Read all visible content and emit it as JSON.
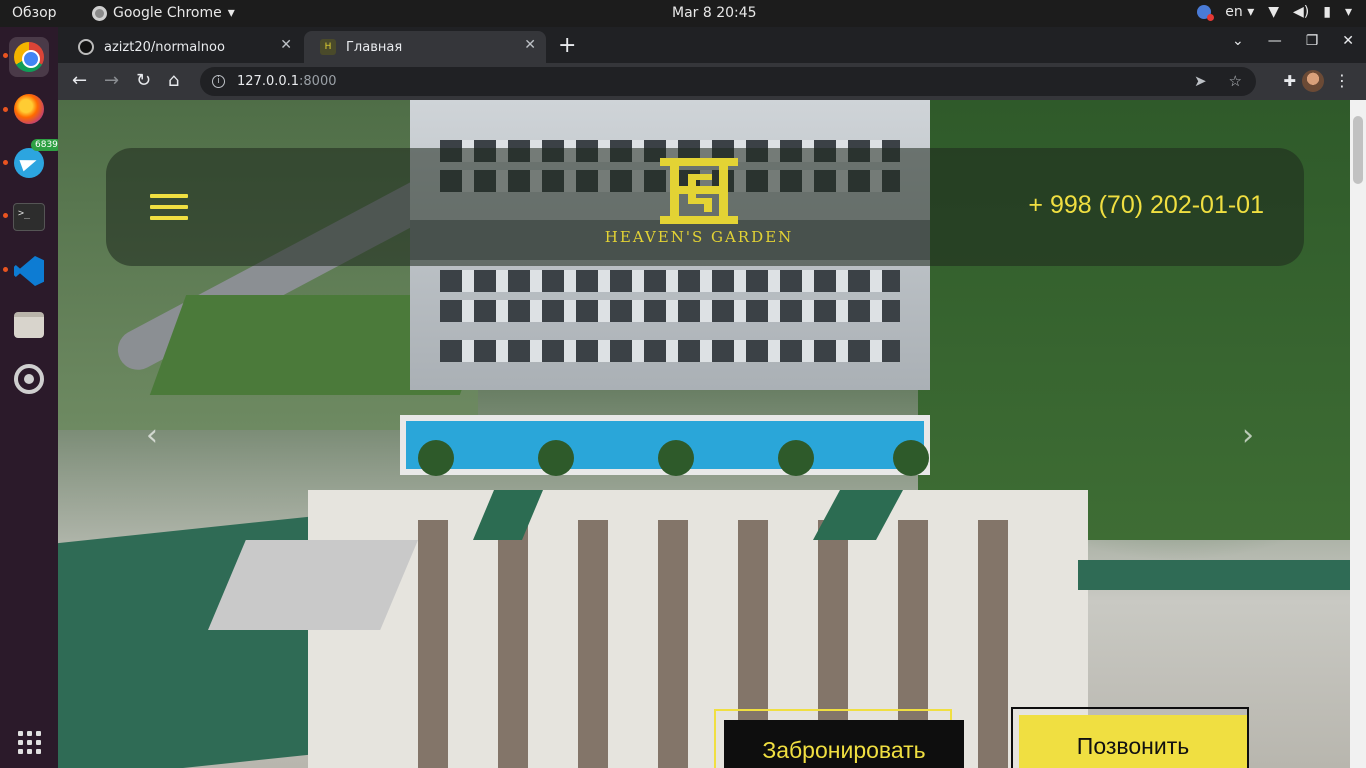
{
  "os": {
    "activities": "Обзор",
    "active_app": "Google Chrome",
    "clock": "Mar 8  20:45",
    "language": "en"
  },
  "dock": {
    "telegram_badge": "6839",
    "items": [
      "chrome-icon",
      "firefox-icon",
      "telegram-icon",
      "terminal-icon",
      "vscode-icon",
      "files-icon",
      "settings-icon"
    ]
  },
  "browser": {
    "tabs": [
      {
        "title": "azizt20/normalnoo",
        "active": false
      },
      {
        "title": "Главная",
        "active": true
      }
    ],
    "url_host": "127.0.0.1",
    "url_port": ":8000"
  },
  "site": {
    "logo_text": "HEAVEN'S GARDEN",
    "phone": "+ 998 (70) 202-01-01",
    "book_button": "Забронировать",
    "call_button": "Позвонить",
    "accent_color": "#f0df41"
  }
}
